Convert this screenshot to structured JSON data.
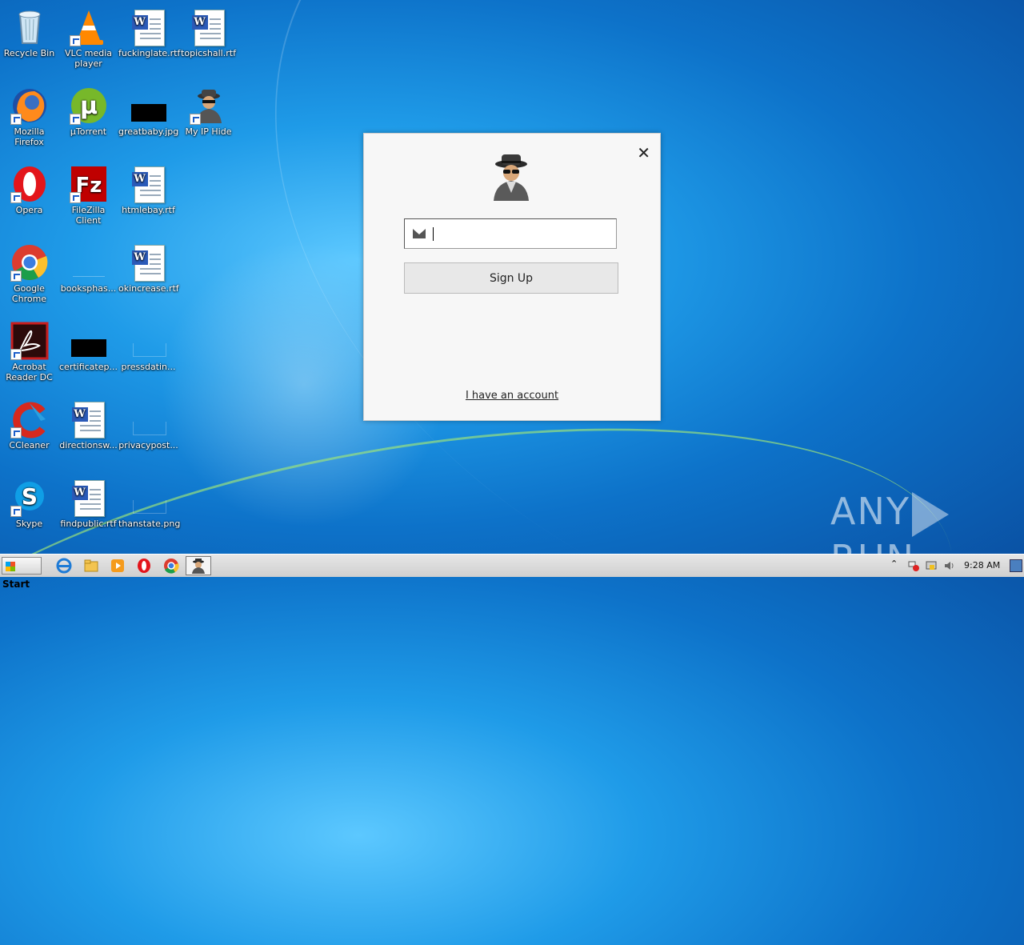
{
  "desktop": {
    "icons": [
      {
        "label": "Recycle Bin"
      },
      {
        "label": "VLC media player"
      },
      {
        "label": "fuckinglate.rtf"
      },
      {
        "label": "topicshall.rtf"
      },
      {
        "label": "Mozilla Firefox"
      },
      {
        "label": "µTorrent"
      },
      {
        "label": "greatbaby.jpg"
      },
      {
        "label": "My IP Hide"
      },
      {
        "label": "Opera"
      },
      {
        "label": "FileZilla Client"
      },
      {
        "label": "htmlebay.rtf"
      },
      {
        "label": "Google Chrome"
      },
      {
        "label": "booksphas..."
      },
      {
        "label": "okincrease.rtf"
      },
      {
        "label": "Acrobat Reader DC"
      },
      {
        "label": "certificatep..."
      },
      {
        "label": "pressdatin..."
      },
      {
        "label": "CCleaner"
      },
      {
        "label": "directionsw..."
      },
      {
        "label": "privacypost..."
      },
      {
        "label": "Skype"
      },
      {
        "label": "findpublic.rtf"
      },
      {
        "label": "thanstate.png"
      }
    ]
  },
  "dialog": {
    "close_symbol": "✕",
    "email_value": "",
    "signup_label": "Sign Up",
    "account_link": "I have an account"
  },
  "watermark": {
    "left": "ANY",
    "right": "RUN"
  },
  "taskbar": {
    "start_label": "Start",
    "clock": "9:28 AM"
  }
}
